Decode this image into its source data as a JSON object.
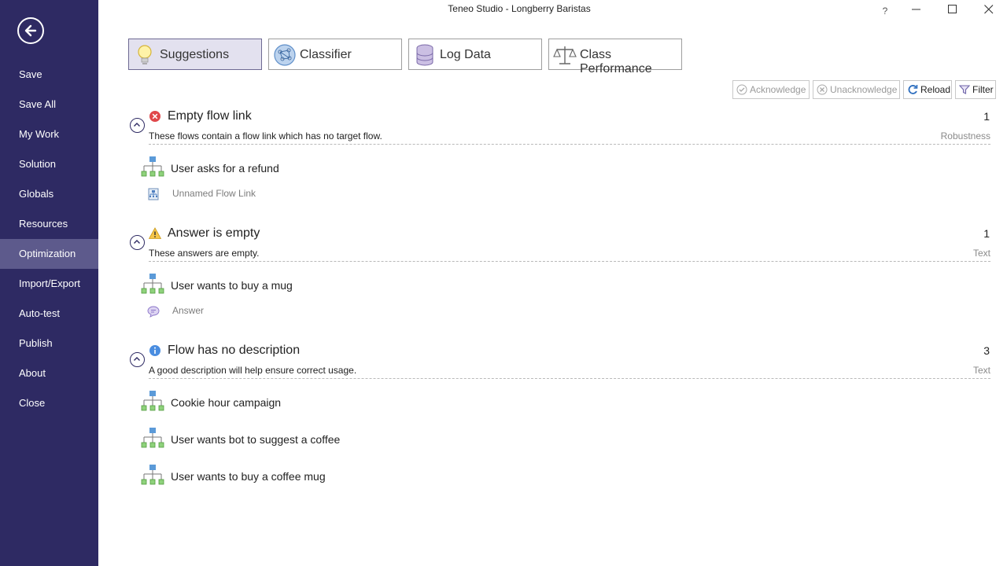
{
  "window": {
    "title": "Teneo Studio - Longberry Baristas",
    "help": "?"
  },
  "sidebar": {
    "items": [
      {
        "label": "Save"
      },
      {
        "label": "Save All"
      },
      {
        "label": "My Work"
      },
      {
        "label": "Solution"
      },
      {
        "label": "Globals"
      },
      {
        "label": "Resources"
      },
      {
        "label": "Optimization",
        "active": true
      },
      {
        "label": "Import/Export"
      },
      {
        "label": "Auto-test"
      },
      {
        "label": "Publish"
      },
      {
        "label": "About"
      },
      {
        "label": "Close"
      }
    ]
  },
  "tabs": [
    {
      "label": "Suggestions",
      "icon": "lightbulb-icon",
      "active": true
    },
    {
      "label": "Classifier",
      "icon": "network-icon"
    },
    {
      "label": "Log Data",
      "icon": "database-icon"
    },
    {
      "label": "Class Performance",
      "icon": "scales-icon"
    }
  ],
  "toolbar": {
    "acknowledge": "Acknowledge",
    "unacknowledge": "Unacknowledge",
    "reload": "Reload",
    "filter": "Filter"
  },
  "groups": [
    {
      "title": "Empty flow link",
      "severity": "error",
      "count": "1",
      "description": "These flows contain a flow link which has no target flow.",
      "category": "Robustness",
      "items": [
        {
          "label": "User asks for a refund",
          "sub": {
            "label": "Unnamed Flow Link",
            "icon": "flow-link-icon"
          }
        }
      ]
    },
    {
      "title": "Answer is empty",
      "severity": "warning",
      "count": "1",
      "description": "These answers are empty.",
      "category": "Text",
      "items": [
        {
          "label": "User wants to buy a mug",
          "sub": {
            "label": "Answer",
            "icon": "speech-bubble-icon"
          }
        }
      ]
    },
    {
      "title": "Flow has no description",
      "severity": "info",
      "count": "3",
      "description": "A good description will help ensure correct usage.",
      "category": "Text",
      "items": [
        {
          "label": "Cookie hour campaign"
        },
        {
          "label": "User wants bot to suggest a coffee"
        },
        {
          "label": "User wants to buy a coffee mug"
        }
      ]
    }
  ],
  "colors": {
    "sidebar": "#2e2a63",
    "sidebar_active": "#5d5a8c",
    "tab_active": "#e3e1ef"
  }
}
